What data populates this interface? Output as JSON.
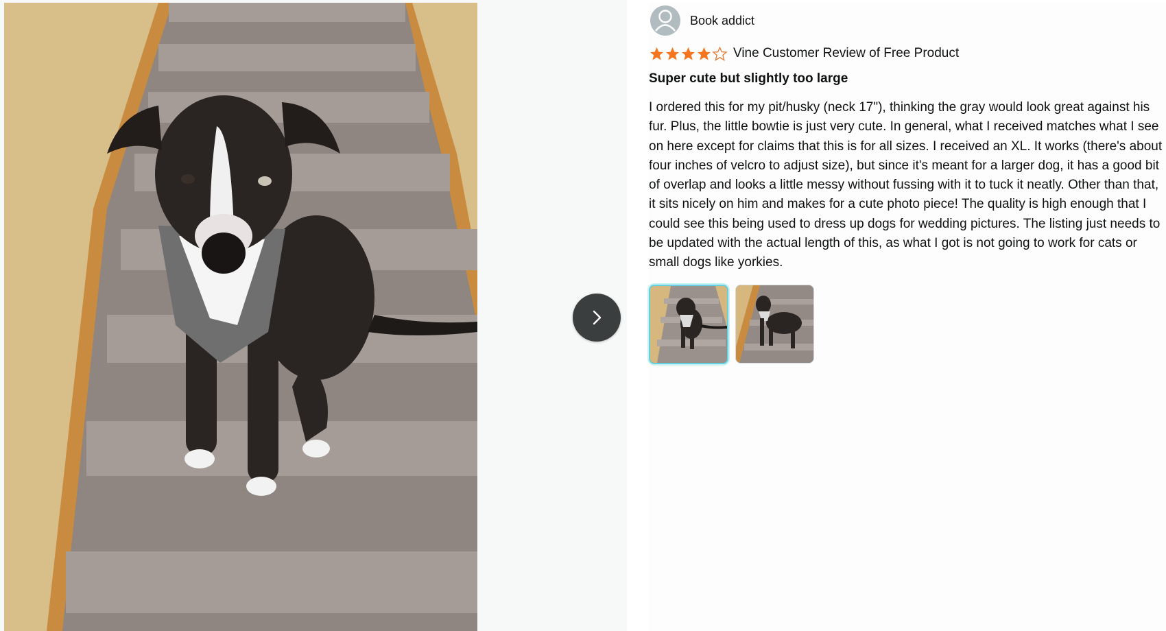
{
  "reviewer": {
    "name": "Book addict",
    "avatar_icon": "user-avatar-icon"
  },
  "rating": {
    "stars": 4,
    "max": 5,
    "star_color": "#f4761f",
    "label": "Vine Customer Review of Free Product"
  },
  "review": {
    "title": "Super cute but slightly too large",
    "body": "I ordered this for my pit/husky (neck 17\"), thinking the gray would look great against his fur. Plus, the little bowtie is just very cute. In general, what I received matches what I see on here except for claims that this is for all sizes. I received an XL. It works (there's about four inches of velcro to adjust size), but since it's meant for a larger dog, it has a good bit of overlap and looks a little messy without fussing with it to tuck it neatly. Other than that, it sits nicely on him and makes for a cute photo piece! The quality is high enough that I could see this being used to dress up dogs for wedding pictures. The listing just needs to be updated with the actual length of this, as what I got is not going to work for cats or small dogs like yorkies."
  },
  "gallery": {
    "next_icon": "chevron-right-icon",
    "selected_index": 0,
    "thumbnail_count": 2,
    "selected_border_color": "#65d0df"
  }
}
